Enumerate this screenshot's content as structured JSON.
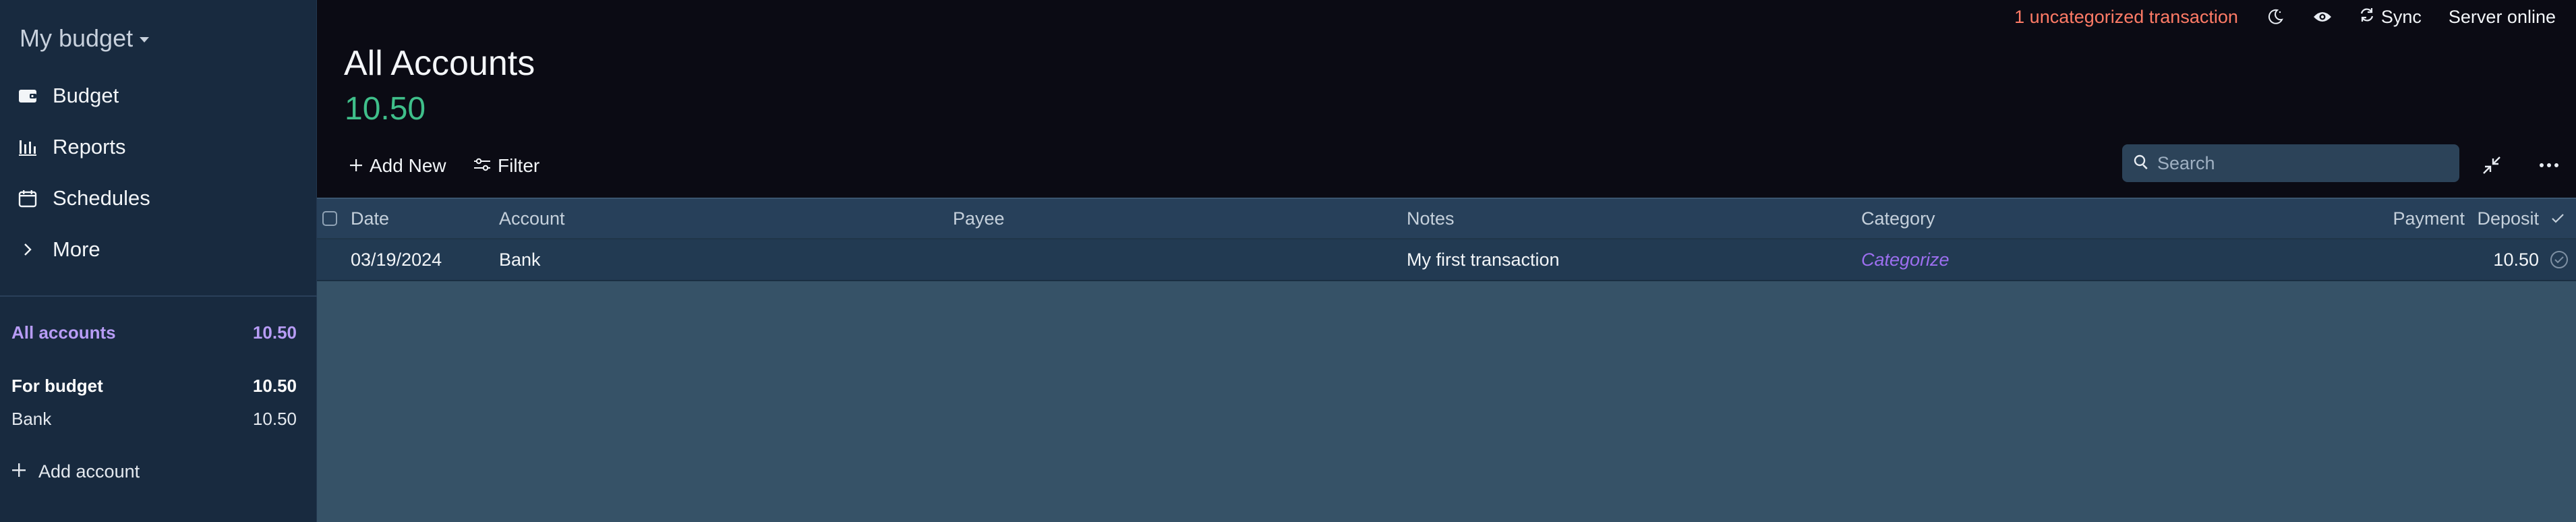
{
  "sidebar": {
    "budget_name": "My budget",
    "nav": [
      {
        "label": "Budget",
        "icon": "wallet-icon"
      },
      {
        "label": "Reports",
        "icon": "bar-chart-icon"
      },
      {
        "label": "Schedules",
        "icon": "calendar-icon"
      },
      {
        "label": "More",
        "icon": "chevron-right-icon"
      }
    ],
    "all_accounts": {
      "label": "All accounts",
      "value": "10.50"
    },
    "for_budget": {
      "label": "For budget",
      "value": "10.50"
    },
    "accounts": [
      {
        "label": "Bank",
        "value": "10.50"
      }
    ],
    "add_account": "Add account"
  },
  "topbar": {
    "uncategorized": "1 uncategorized transaction",
    "sync": "Sync",
    "server_status": "Server online"
  },
  "header": {
    "title": "All Accounts",
    "balance": "10.50"
  },
  "toolbar": {
    "add_new": "Add New",
    "filter": "Filter",
    "search_placeholder": "Search"
  },
  "table": {
    "columns": {
      "date": "Date",
      "account": "Account",
      "payee": "Payee",
      "notes": "Notes",
      "category": "Category",
      "payment": "Payment",
      "deposit": "Deposit"
    },
    "rows": [
      {
        "date": "03/19/2024",
        "account": "Bank",
        "payee": "",
        "notes": "My first transaction",
        "category": "Categorize",
        "payment": "",
        "deposit": "10.50"
      }
    ]
  },
  "colors": {
    "accent_purple": "#b79cf5",
    "balance_green": "#3fbf8a",
    "warning_orange": "#ff7b66",
    "sidebar_bg": "#182a3f"
  }
}
